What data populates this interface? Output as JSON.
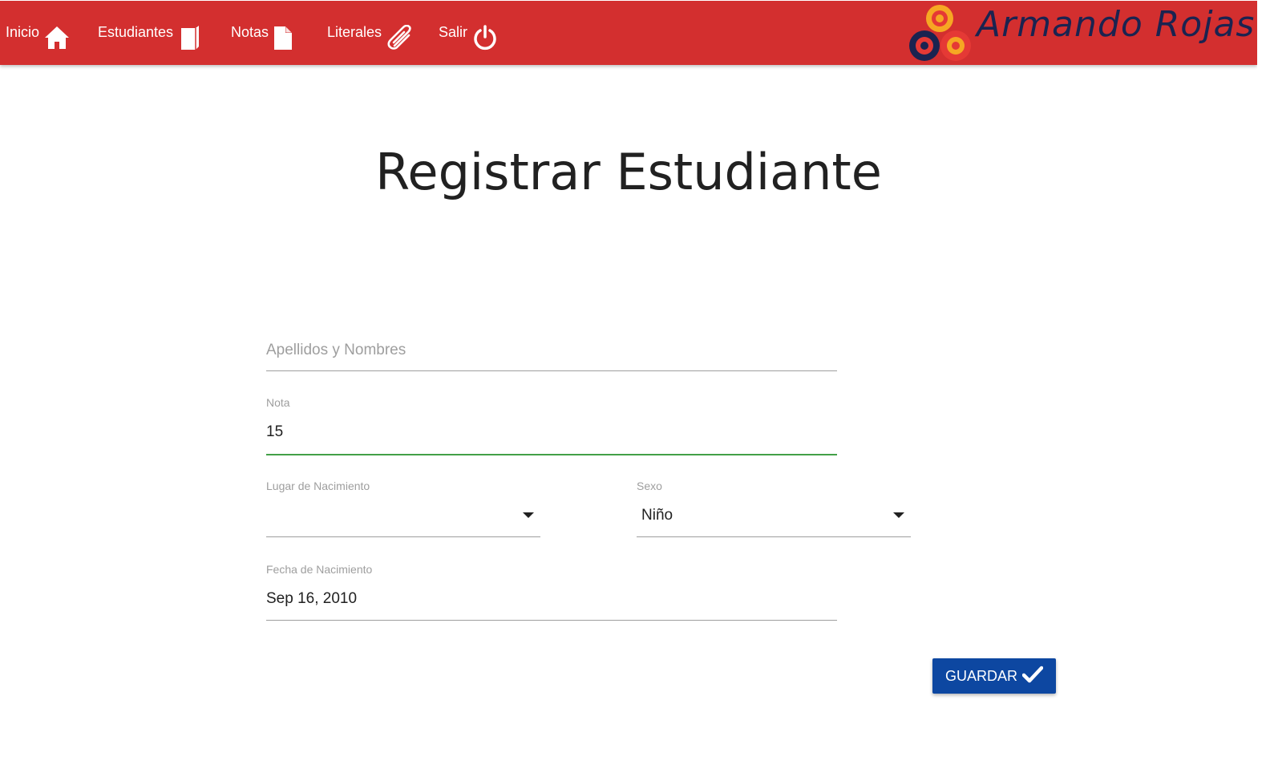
{
  "nav": {
    "items": [
      {
        "label": "Inicio",
        "icon": "home-icon"
      },
      {
        "label": "Estudiantes",
        "icon": "book-icon"
      },
      {
        "label": "Notas",
        "icon": "file-icon"
      },
      {
        "label": "Literales",
        "icon": "paperclip-icon"
      },
      {
        "label": "Salir",
        "icon": "power-icon"
      }
    ],
    "brand": "Armando Rojas"
  },
  "page": {
    "title": "Registrar Estudiante"
  },
  "form": {
    "nombre": {
      "placeholder": "Apellidos y Nombres",
      "value": ""
    },
    "nota": {
      "label": "Nota",
      "value": "15"
    },
    "lugar": {
      "label": "Lugar de Nacimiento",
      "value": ""
    },
    "sexo": {
      "label": "Sexo",
      "value": "Niño"
    },
    "fecha": {
      "label": "Fecha de Nacimiento",
      "value": "Sep 16, 2010"
    },
    "submit_label": "GUARDAR"
  },
  "colors": {
    "navbar": "#d32f2f",
    "button": "#0d47a1",
    "active_underline": "#43a047",
    "brand_text": "#1b2350"
  }
}
